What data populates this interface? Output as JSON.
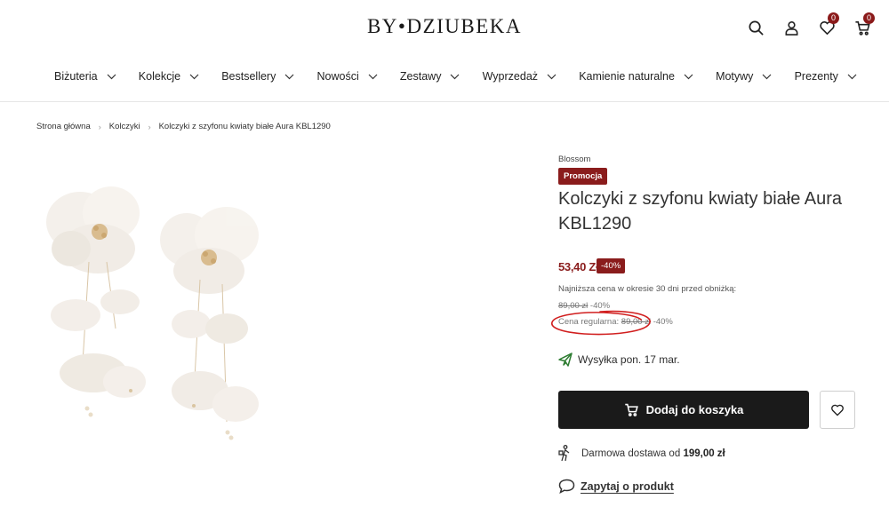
{
  "header": {
    "logo_text": "BY•DZIUBEKA",
    "wishlist_count": "0",
    "cart_count": "0"
  },
  "nav": {
    "items": [
      {
        "label": "Biżuteria"
      },
      {
        "label": "Kolekcje"
      },
      {
        "label": "Bestsellery"
      },
      {
        "label": "Nowości"
      },
      {
        "label": "Zestawy"
      },
      {
        "label": "Wyprzedaż"
      },
      {
        "label": "Kamienie naturalne"
      },
      {
        "label": "Motywy"
      },
      {
        "label": "Prezenty"
      }
    ]
  },
  "breadcrumb": {
    "items": [
      "Strona główna",
      "Kolczyki",
      "Kolczyki z szyfonu kwiaty białe Aura KBL1290"
    ]
  },
  "product": {
    "brand": "Blossom",
    "promo_label": "Promocja",
    "title": "Kolczyki z szyfonu kwiaty białe Aura KBL1290",
    "price": "53,40 Zł",
    "discount": "-40%",
    "lowest_price_label": "Najniższa cena w okresie 30 dni przed obniżką:",
    "lowest_price_value": "89,00 zł",
    "lowest_price_discount": "-40%",
    "regular_price_label": "Cena regularna:",
    "regular_price_value": "89,00 zł",
    "regular_price_discount": "-40%",
    "shipping_text": "Wysyłka pon. 17 mar.",
    "add_to_cart_label": "Dodaj do koszyka",
    "free_delivery_prefix": "Darmowa dostawa od",
    "free_delivery_amount": "199,00 zł",
    "ask_label": "Zapytaj o produkt"
  },
  "colors": {
    "accent": "#8a1c1c",
    "button_dark": "#1a1a1a",
    "annotation_red": "#d11f1f"
  }
}
